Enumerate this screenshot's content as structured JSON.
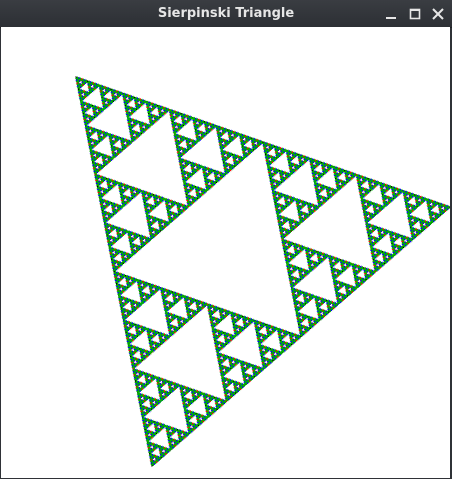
{
  "window": {
    "title": "Sierpinski Triangle",
    "controls": {
      "minimize_icon": "minimize-icon",
      "maximize_icon": "maximize-icon",
      "close_icon": "close-icon"
    },
    "colors": {
      "titlebar": "#2f3237",
      "title_text": "#e6e6e6",
      "canvas_background": "#ffffff"
    }
  },
  "fractal": {
    "shape": "Sierpinski triangle",
    "colors": [
      "#000000",
      "#ff0000",
      "#0000ff",
      "#00b000"
    ]
  }
}
